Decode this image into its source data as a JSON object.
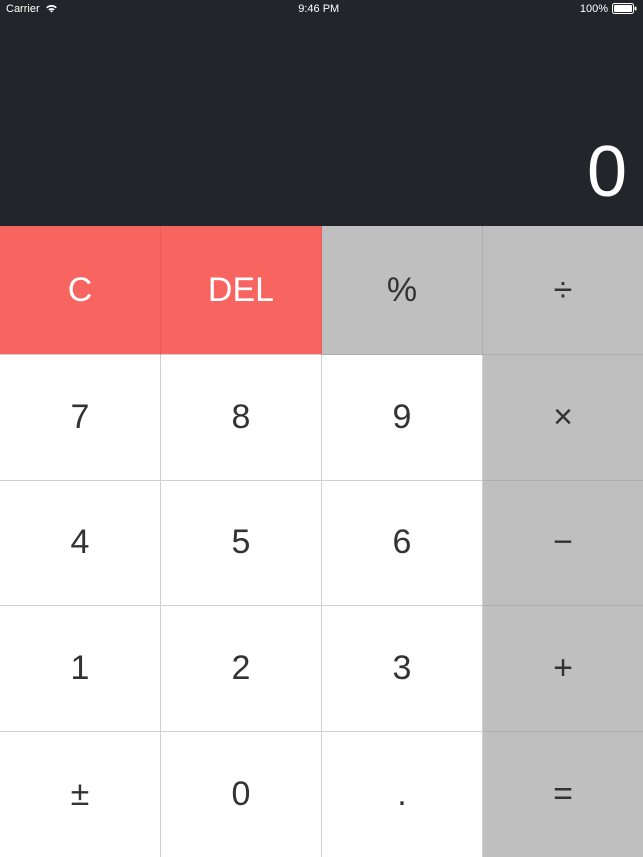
{
  "status_bar": {
    "carrier": "Carrier",
    "time": "9:46 PM",
    "battery": "100%"
  },
  "display": {
    "value": "0"
  },
  "keys": {
    "clear": "C",
    "delete": "DEL",
    "percent": "%",
    "divide": "÷",
    "multiply": "×",
    "minus": "−",
    "plus": "+",
    "equals": "=",
    "plusminus": "±",
    "decimal": ".",
    "d0": "0",
    "d1": "1",
    "d2": "2",
    "d3": "3",
    "d4": "4",
    "d5": "5",
    "d6": "6",
    "d7": "7",
    "d8": "8",
    "d9": "9"
  }
}
